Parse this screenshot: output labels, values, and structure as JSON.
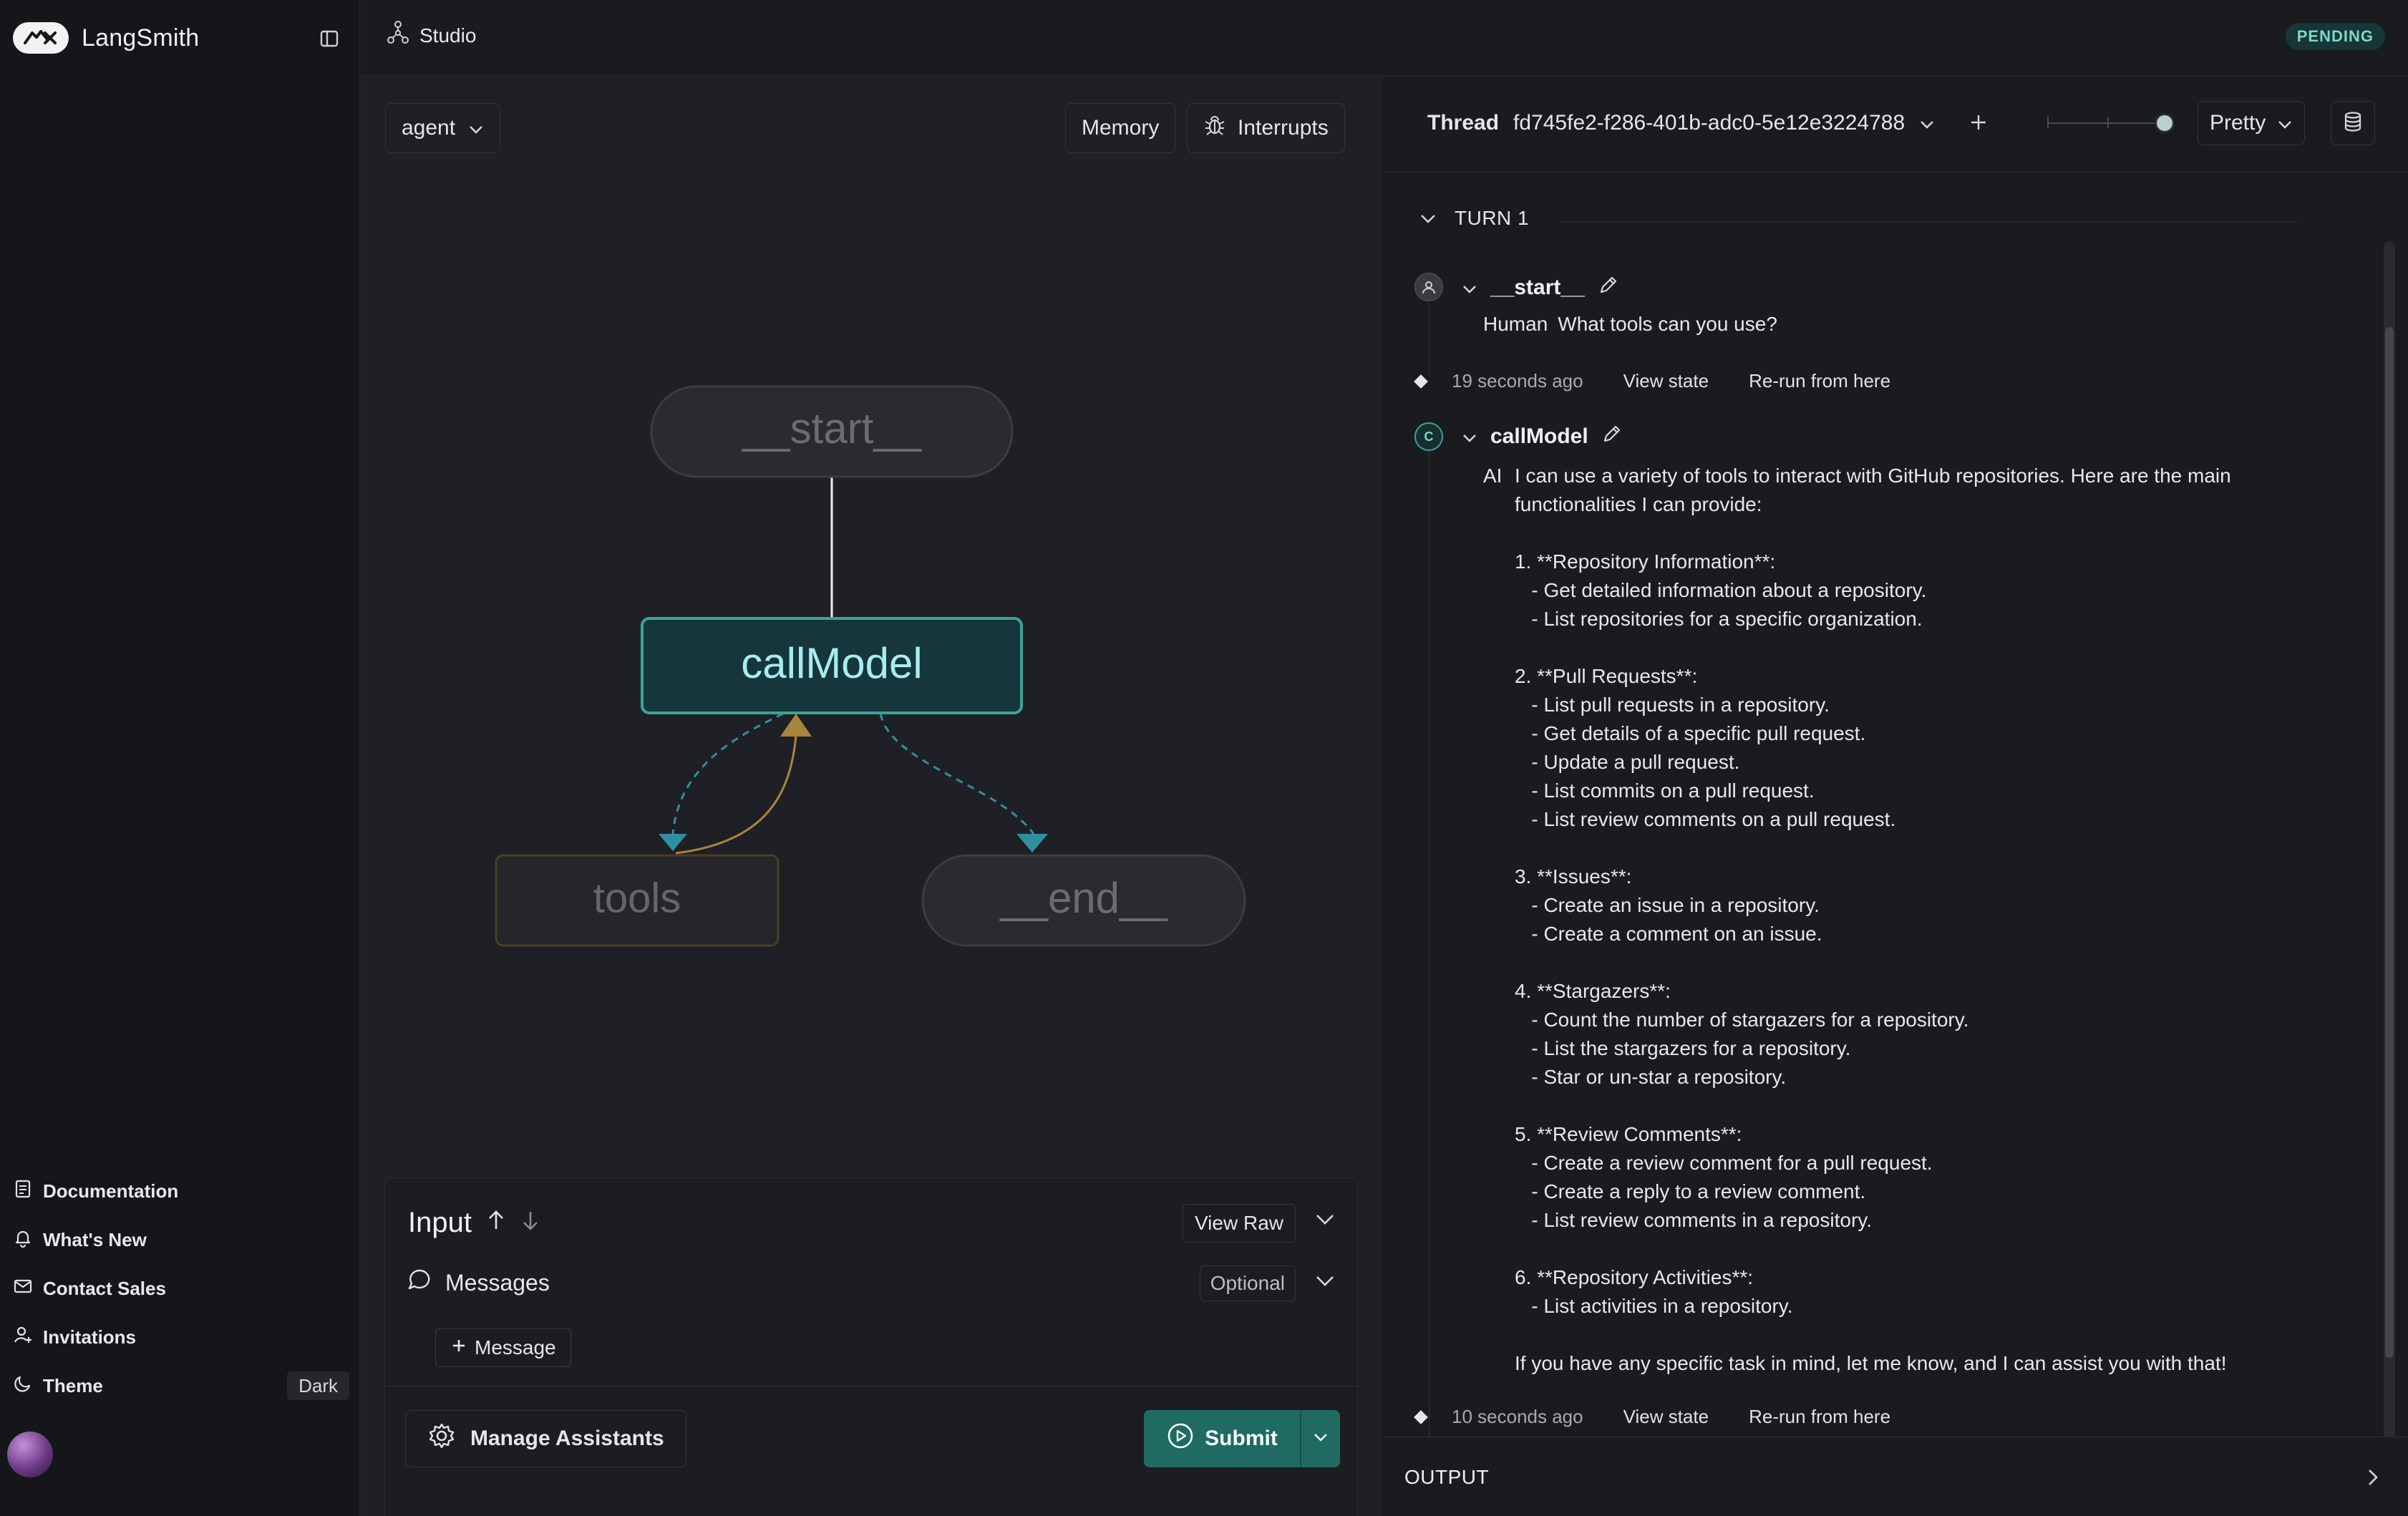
{
  "sidebar": {
    "brand": "LangSmith",
    "links": [
      {
        "label": "Documentation",
        "icon": "document-icon"
      },
      {
        "label": "What's New",
        "icon": "bell-icon"
      },
      {
        "label": "Contact Sales",
        "icon": "mail-icon"
      },
      {
        "label": "Invitations",
        "icon": "user-plus-icon"
      },
      {
        "label": "Theme",
        "icon": "moon-icon",
        "value": "Dark"
      }
    ]
  },
  "topbar": {
    "studio_label": "Studio",
    "status": "PENDING"
  },
  "graph": {
    "agent_select": "agent",
    "memory_label": "Memory",
    "interrupts_label": "Interrupts",
    "nodes": {
      "start": "__start__",
      "call_model": "callModel",
      "tools": "tools",
      "end": "__end__"
    },
    "colors": {
      "active": "#3aa39a",
      "tools_edge": "#a8843f",
      "conditional_edge": "#2f8fa0"
    }
  },
  "input": {
    "title": "Input",
    "view_raw": "View Raw",
    "messages_label": "Messages",
    "optional_label": "Optional",
    "add_message": "Message",
    "manage_assistants": "Manage Assistants",
    "submit": "Submit"
  },
  "thread": {
    "label": "Thread",
    "id": "fd745fe2-f286-401b-adc0-5e12e3224788",
    "view_mode": "Pretty",
    "turn_label": "TURN 1",
    "steps": [
      {
        "node": "__start__",
        "role": "Human",
        "message": "What tools can you use?",
        "time": "19 seconds ago",
        "view_state": "View state",
        "rerun": "Re-run from here"
      },
      {
        "node": "callModel",
        "avatar_letter": "C",
        "role": "AI",
        "message": "I can use a variety of tools to interact with GitHub repositories. Here are the main functionalities I can provide:\n\n1. **Repository Information**:\n   - Get detailed information about a repository.\n   - List repositories for a specific organization.\n\n2. **Pull Requests**:\n   - List pull requests in a repository.\n   - Get details of a specific pull request.\n   - Update a pull request.\n   - List commits on a pull request.\n   - List review comments on a pull request.\n\n3. **Issues**:\n   - Create an issue in a repository.\n   - Create a comment on an issue.\n\n4. **Stargazers**:\n   - Count the number of stargazers for a repository.\n   - List the stargazers for a repository.\n   - Star or un-star a repository.\n\n5. **Review Comments**:\n   - Create a review comment for a pull request.\n   - Create a reply to a review comment.\n   - List review comments in a repository.\n\n6. **Repository Activities**:\n   - List activities in a repository.\n\nIf you have any specific task in mind, let me know, and I can assist you with that!",
        "time": "10 seconds ago",
        "view_state": "View state",
        "rerun": "Re-run from here"
      }
    ],
    "output_label": "OUTPUT"
  }
}
